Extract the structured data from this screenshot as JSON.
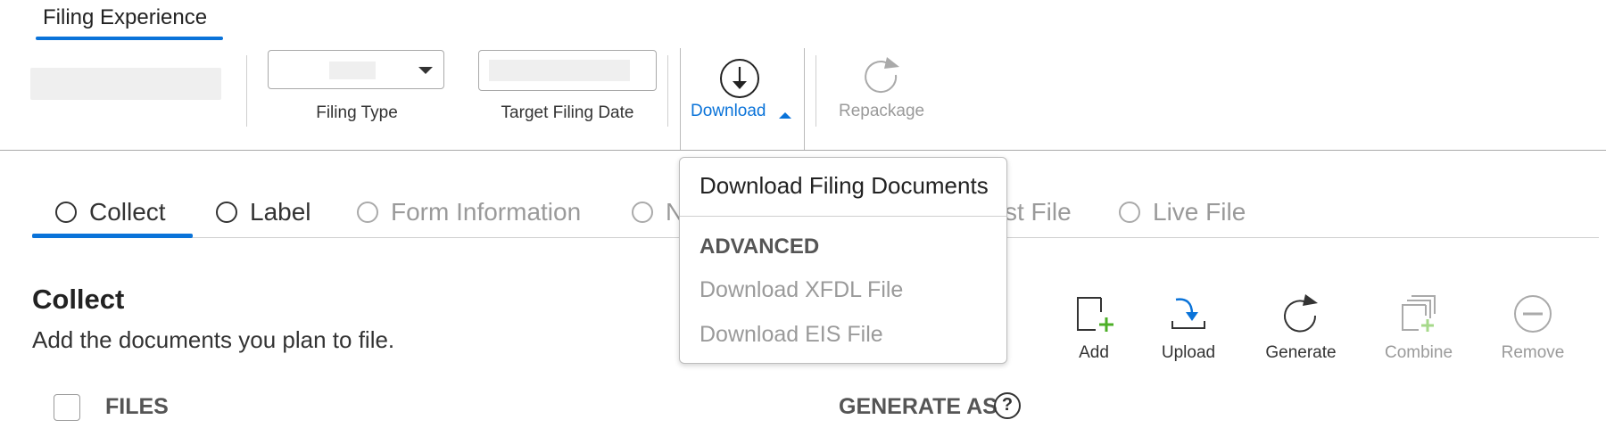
{
  "app_tab": {
    "label": "Filing Experience"
  },
  "toolbar": {
    "filing_type_label": "Filing Type",
    "target_date_label": "Target Filing Date",
    "download_label": "Download",
    "repackage_label": "Repackage"
  },
  "steps": [
    {
      "label": "Collect",
      "state": "active"
    },
    {
      "label": "Label",
      "state": "enabled"
    },
    {
      "label": "Form Information",
      "state": "disabled"
    },
    {
      "label": "N",
      "state": "disabled"
    },
    {
      "label": "st File",
      "state": "disabled"
    },
    {
      "label": "Live File",
      "state": "disabled"
    }
  ],
  "section": {
    "title": "Collect",
    "subtitle": "Add the documents you plan to file."
  },
  "actions": {
    "add": "Add",
    "upload": "Upload",
    "generate": "Generate",
    "combine": "Combine",
    "remove": "Remove"
  },
  "table": {
    "files_header": "FILES",
    "generate_as_header": "GENERATE AS",
    "help_glyph": "?"
  },
  "download_menu": {
    "primary_item": "Download Filing Documents",
    "section_header": "ADVANCED",
    "disabled_items": [
      "Download XFDL File",
      "Download EIS File"
    ]
  },
  "colors": {
    "accent": "#0a73d9",
    "add_plus": "#4caf27",
    "combine_plus": "#a6d98a",
    "muted_text": "#9a9a9a"
  },
  "icons": [
    "download-icon",
    "repackage-icon",
    "add-icon",
    "upload-icon",
    "generate-icon",
    "combine-icon",
    "remove-icon",
    "help-icon"
  ]
}
